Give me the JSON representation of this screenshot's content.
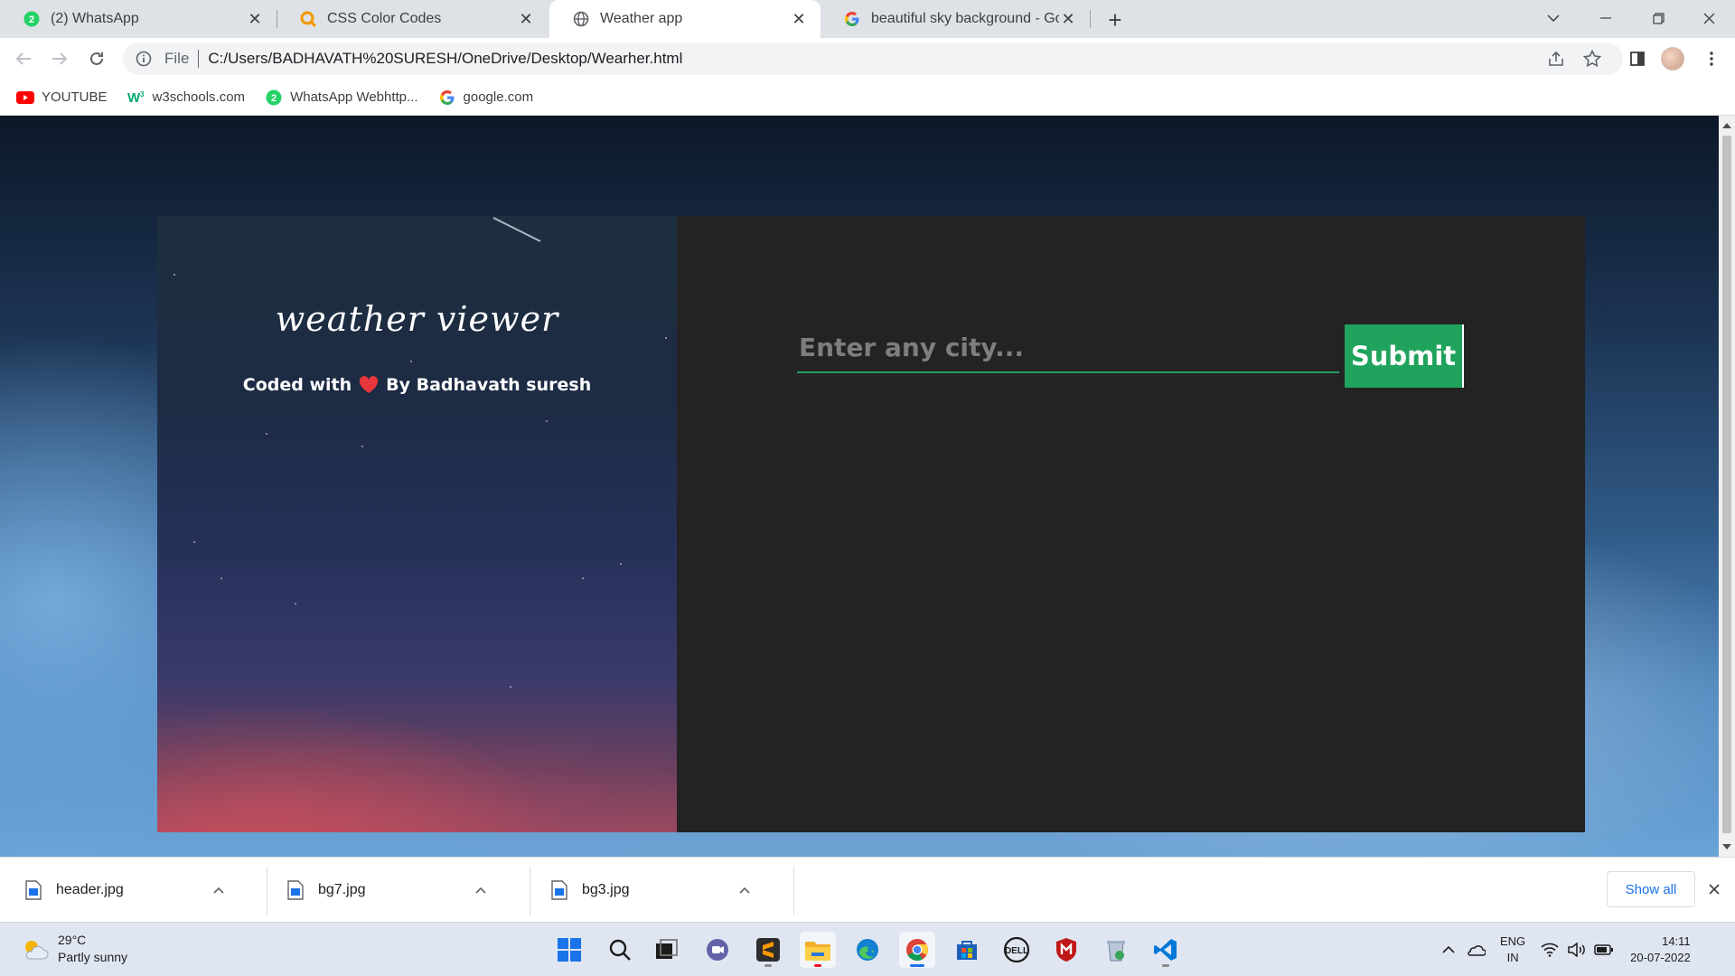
{
  "browser": {
    "tabs": [
      {
        "label": "(2) WhatsApp",
        "icon": "whatsapp-icon",
        "active": false
      },
      {
        "label": "CSS Color Codes",
        "icon": "css-color-codes-icon",
        "active": false
      },
      {
        "label": "Weather app",
        "icon": "globe-icon",
        "active": true
      },
      {
        "label": "beautiful sky background - Goog",
        "icon": "google-icon",
        "active": false
      }
    ],
    "address": {
      "scheme": "File",
      "url": "C:/Users/BADHAVATH%20SURESH/OneDrive/Desktop/Wearher.html"
    },
    "bookmarks": [
      {
        "label": "YOUTUBE",
        "icon": "youtube-icon"
      },
      {
        "label": "w3schools.com",
        "icon": "w3schools-icon"
      },
      {
        "label": "WhatsApp Webhttp...",
        "icon": "whatsapp-icon"
      },
      {
        "label": "google.com",
        "icon": "google-icon"
      }
    ]
  },
  "page": {
    "title": "weather viewer",
    "credit_prefix": "Coded with",
    "credit_suffix": "By Badhavath suresh",
    "search": {
      "placeholder": "Enter any city...",
      "value": ""
    },
    "submit_label": "Submit",
    "colors": {
      "accent": "#1fa35c",
      "panel": "#232323",
      "heart": "#e8363c"
    }
  },
  "downloads": {
    "files": [
      {
        "name": "header.jpg"
      },
      {
        "name": "bg7.jpg"
      },
      {
        "name": "bg3.jpg"
      }
    ],
    "show_all_label": "Show all"
  },
  "taskbar": {
    "weather": {
      "temp": "29°C",
      "condition": "Partly sunny"
    },
    "apps": [
      "start-icon",
      "search-icon",
      "task-view-icon",
      "teams-chat-icon",
      "sublime-text-icon",
      "file-explorer-icon",
      "edge-icon",
      "chrome-icon",
      "microsoft-store-icon",
      "dell-icon",
      "mcafee-icon",
      "recycle-icon",
      "vscode-icon"
    ],
    "language": {
      "line1": "ENG",
      "line2": "IN"
    },
    "time": "14:11",
    "date": "20-07-2022"
  }
}
